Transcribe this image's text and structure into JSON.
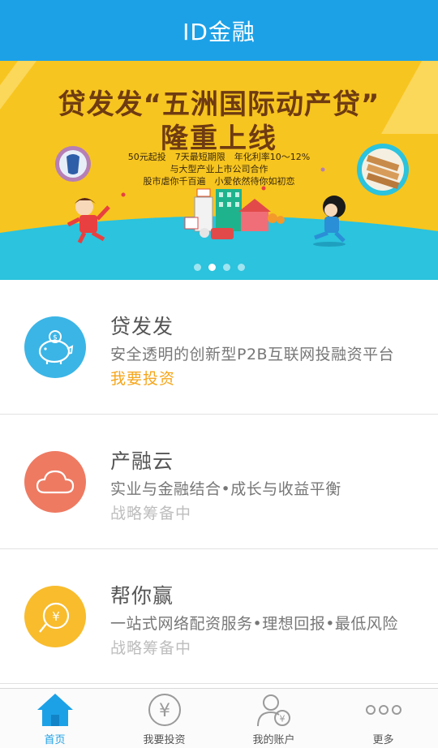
{
  "app": {
    "title": "ID金融"
  },
  "banner": {
    "title_line1": "贷发发“五洲国际动产贷”",
    "title_line2": "隆重上线",
    "line1": "50元起投　7天最短期限　年化利率10～12%",
    "line2": "与大型产业上市公司合作",
    "line3": "股市虐你千百遍　小爱依然待你如初恋",
    "slides_total": 4,
    "active_slide": 2,
    "colors": {
      "background": "#f7c51f",
      "ground": "#2bc3dd",
      "title": "#6e3b12"
    }
  },
  "products": [
    {
      "title": "贷发发",
      "desc": "安全透明的创新型P2B互联网投融资平台",
      "action": "我要投资",
      "icon": "piggy-bank-icon",
      "color": "#3bb5e6"
    },
    {
      "title": "产融云",
      "desc": "实业与金融结合•成长与收益平衡",
      "action": "战略筹备中",
      "icon": "cloud-icon",
      "color": "#ee7a62"
    },
    {
      "title": "帮你赢",
      "desc": "一站式网络配资服务•理想回报•最低风险",
      "action": "战略筹备中",
      "icon": "yuan-coin-icon",
      "color": "#f8bc2d"
    }
  ],
  "tabs": [
    {
      "label": "首页",
      "icon": "home-icon",
      "active": true
    },
    {
      "label": "我要投资",
      "icon": "yuan-circle-icon",
      "active": false
    },
    {
      "label": "我的账户",
      "icon": "user-account-icon",
      "active": false
    },
    {
      "label": "更多",
      "icon": "more-dots-icon",
      "active": false
    }
  ],
  "colors": {
    "primary": "#1ca1e7",
    "accent": "#f6a61b",
    "muted": "#bdbdbd"
  }
}
